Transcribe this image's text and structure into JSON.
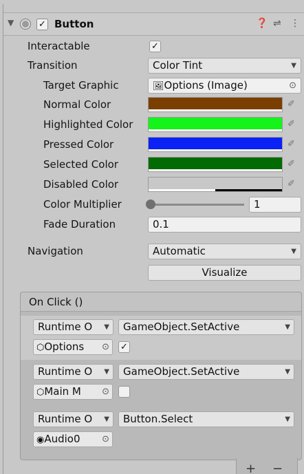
{
  "component": {
    "title": "Button",
    "fold_glyph": "▼",
    "enabled_check": "✓",
    "help_glyph": "❓",
    "presets_glyph": "⇌",
    "menu_glyph": "⋮"
  },
  "fields": {
    "interactable": {
      "label": "Interactable",
      "check": "✓"
    },
    "transition": {
      "label": "Transition",
      "value": "Color Tint"
    },
    "target_graphic": {
      "label": "Target Graphic",
      "value": "Options (Image)",
      "icon": "🖼",
      "target": "⊙"
    },
    "normal_color": {
      "label": "Normal Color",
      "color": "#7a3f00"
    },
    "highlighted_color": {
      "label": "Highlighted Color",
      "color": "#14f41a"
    },
    "pressed_color": {
      "label": "Pressed Color",
      "color": "#0b22f5"
    },
    "selected_color": {
      "label": "Selected Color",
      "color": "#036b03"
    },
    "disabled_color": {
      "label": "Disabled Color",
      "color": "#c8c8c8"
    },
    "color_multiplier": {
      "label": "Color Multiplier",
      "value": "1",
      "slider_fraction": 0.0
    },
    "fade_duration": {
      "label": "Fade Duration",
      "value": "0.1"
    },
    "navigation": {
      "label": "Navigation",
      "value": "Automatic"
    },
    "visualize": {
      "label": "Visualize"
    }
  },
  "picker_glyph": "✐",
  "dropdown_glyph": "▼",
  "on_click": {
    "title": "On Click ()",
    "entries": [
      {
        "mode": "Runtime O",
        "function": "GameObject.SetActive",
        "object": "Options",
        "object_icon": "⬡",
        "target": "⊙",
        "arg_check": "✓"
      },
      {
        "mode": "Runtime O",
        "function": "GameObject.SetActive",
        "object": "Main M",
        "object_icon": "⬡",
        "target": "⊙",
        "arg_check": ""
      },
      {
        "mode": "Runtime O",
        "function": "Button.Select",
        "object": "Audio0",
        "object_icon": "◉",
        "target": "⊙"
      }
    ],
    "add": "+",
    "remove": "−"
  }
}
